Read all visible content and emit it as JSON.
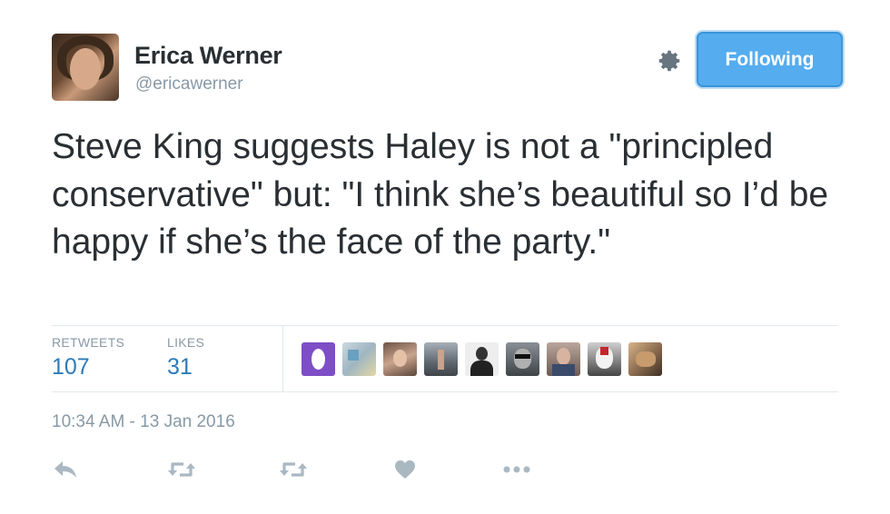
{
  "author": {
    "name": "Erica Werner",
    "handle": "@ericawerner"
  },
  "follow_button": {
    "label": "Following"
  },
  "tweet": {
    "text": "Steve King suggests Haley is not a \"principled conservative\" but: \"I think she’s beautiful so I’d be happy if she’s the face of the party.\""
  },
  "stats": {
    "retweets_label": "RETWEETS",
    "retweets_value": "107",
    "likes_label": "LIKES",
    "likes_value": "31"
  },
  "likers": [
    {
      "name": "liker-avatar-1",
      "color": "#7e4ec6"
    },
    {
      "name": "liker-avatar-2",
      "color": "#b9c9d2"
    },
    {
      "name": "liker-avatar-3",
      "color": "#9a7a6a"
    },
    {
      "name": "liker-avatar-4",
      "color": "#7d8790"
    },
    {
      "name": "liker-avatar-5",
      "color": "#e8e8e8"
    },
    {
      "name": "liker-avatar-6",
      "color": "#5a6066"
    },
    {
      "name": "liker-avatar-7",
      "color": "#7f6f68"
    },
    {
      "name": "liker-avatar-8",
      "color": "#4a4a4a"
    },
    {
      "name": "liker-avatar-9",
      "color": "#8e6f52"
    }
  ],
  "timestamp": "10:34 AM - 13 Jan 2016",
  "icons": {
    "settings": "gear-icon",
    "reply": "reply-icon",
    "retweet": "retweet-icon",
    "like": "heart-icon",
    "more": "more-icon"
  },
  "colors": {
    "accent": "#55acee",
    "stat_value": "#2b7bb9",
    "muted": "#8899a6",
    "action_icon": "#aab8c2"
  }
}
